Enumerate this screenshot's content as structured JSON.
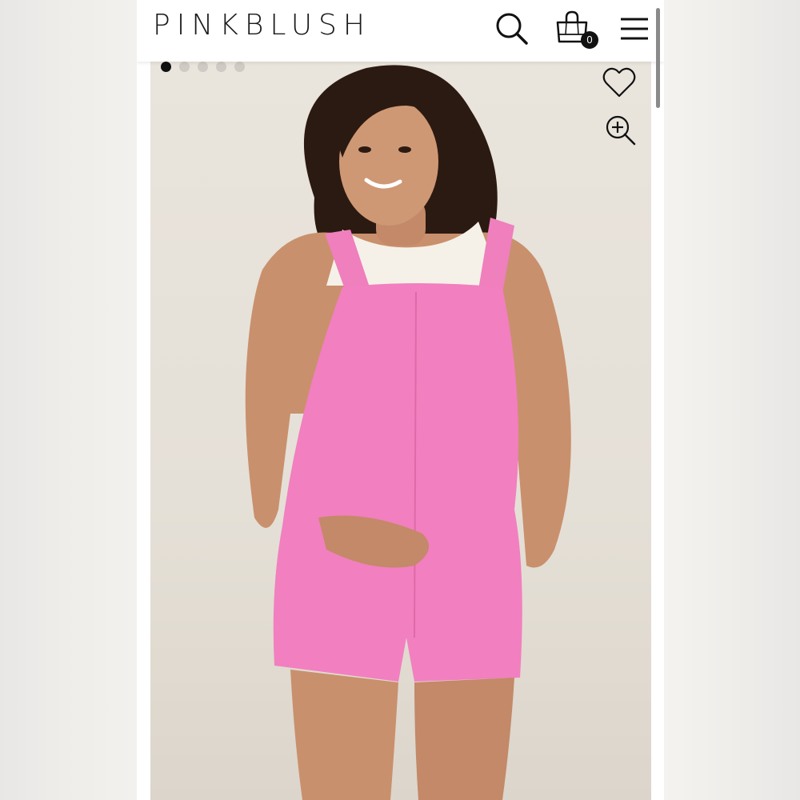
{
  "header": {
    "brand": "PINKBLUSH",
    "cart_count": "0",
    "icons": {
      "search": "search-icon",
      "bag": "shopping-bag-icon",
      "menu": "hamburger-menu-icon"
    }
  },
  "gallery": {
    "total_images": 5,
    "active_index": 0,
    "image_subject": "product-photo",
    "icons": {
      "wishlist": "heart-icon",
      "zoom": "zoom-in-icon"
    }
  },
  "colors": {
    "product_pink": "#f27fbf",
    "backdrop": "#e7e2da",
    "ink": "#111111"
  }
}
